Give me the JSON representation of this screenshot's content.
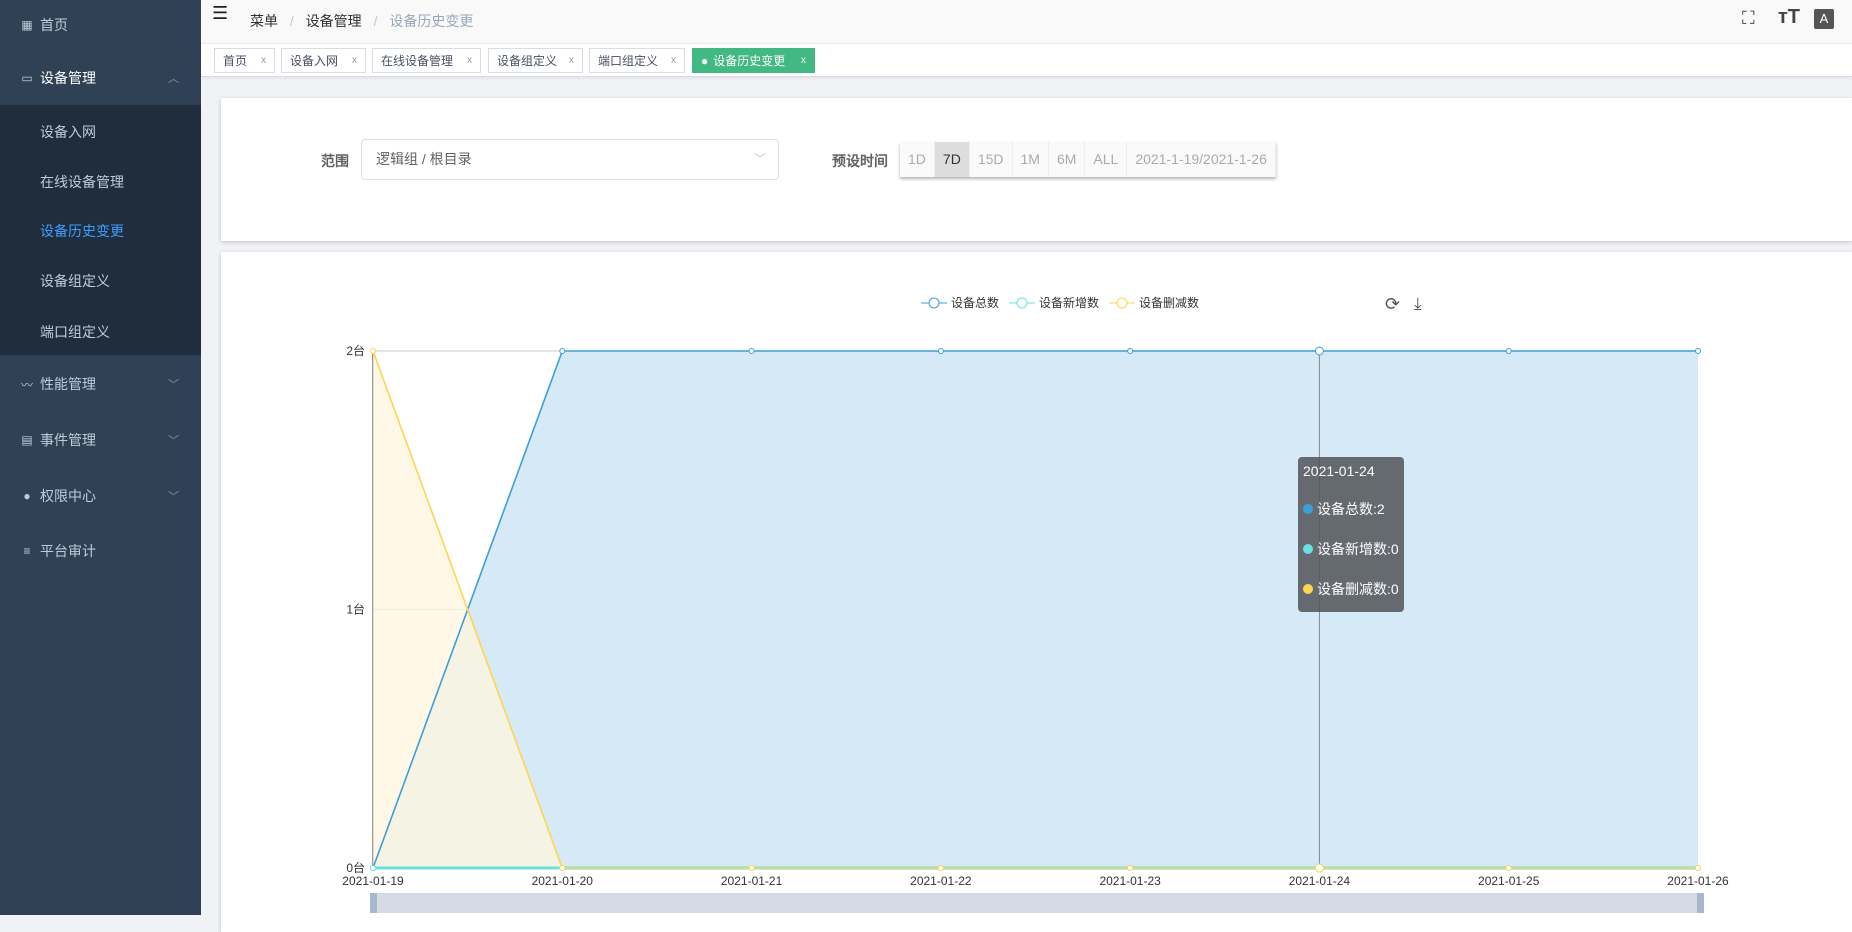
{
  "sidebar": {
    "home": "首页",
    "device_mgmt": "设备管理",
    "sub_items": [
      "设备入网",
      "在线设备管理",
      "设备历史变更",
      "设备组定义",
      "端口组定义"
    ],
    "perf": "性能管理",
    "event": "事件管理",
    "auth": "权限中心",
    "audit": "平台审计"
  },
  "header": {
    "breadcrumb": [
      "菜单",
      "设备管理",
      "设备历史变更"
    ],
    "sep": "/"
  },
  "tabs": [
    {
      "label": "首页"
    },
    {
      "label": "设备入网"
    },
    {
      "label": "在线设备管理"
    },
    {
      "label": "设备组定义"
    },
    {
      "label": "端口组定义"
    },
    {
      "label": "设备历史变更",
      "active": true
    }
  ],
  "tab_close": "x",
  "filter": {
    "scope_label": "范围",
    "scope_value": "逻辑组 / 根目录",
    "time_label": "预设时间",
    "time_buttons": [
      "1D",
      "7D",
      "15D",
      "1M",
      "6M",
      "ALL",
      "2021-1-19/2021-1-26"
    ],
    "time_selected": "7D"
  },
  "tooltip": {
    "title": "2021-01-24",
    "rows": [
      "设备总数:2",
      "设备新增数:0",
      "设备删减数:0"
    ]
  },
  "chart_data": {
    "type": "line",
    "categories": [
      "2021-01-19",
      "2021-01-20",
      "2021-01-21",
      "2021-01-22",
      "2021-01-23",
      "2021-01-24",
      "2021-01-25",
      "2021-01-26"
    ],
    "series": [
      {
        "name": "设备总数",
        "values": [
          0,
          2,
          2,
          2,
          2,
          2,
          2,
          2
        ],
        "color": "#3ba0d8",
        "area": "#d6e9f7"
      },
      {
        "name": "设备新增数",
        "values": [
          0,
          0,
          0,
          0,
          0,
          0,
          0,
          0
        ],
        "color": "#6be0e0",
        "area": null
      },
      {
        "name": "设备删减数",
        "values": [
          2,
          0,
          0,
          0,
          0,
          0,
          0,
          0
        ],
        "color": "#ffd54f",
        "area": "#fff6dd"
      }
    ],
    "yticks": [
      "0台",
      "1台",
      "2台"
    ],
    "ylim": [
      0,
      2
    ],
    "legend": "top-center",
    "highlight": "2021-01-24"
  }
}
